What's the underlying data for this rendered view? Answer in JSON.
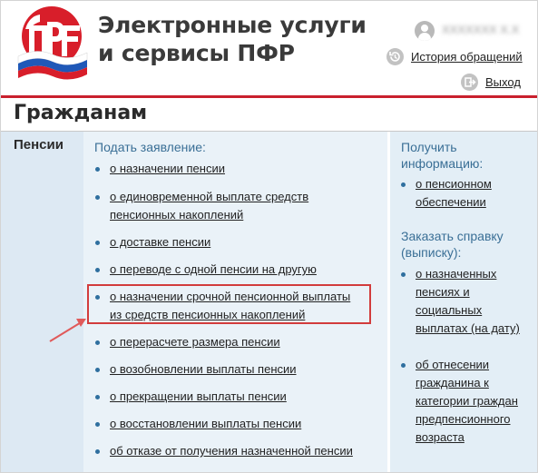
{
  "header": {
    "title_line1": "Электронные услуги",
    "title_line2": "и сервисы ПФР",
    "user_name": "XXXXXXX X.X.",
    "history_link": "История обращений",
    "exit_link": "Выход",
    "icons": {
      "logo": "pfr-logo-icon",
      "user": "user-icon",
      "history": "history-icon",
      "exit": "exit-icon"
    }
  },
  "section_title": "Гражданам",
  "category": "Пенсии",
  "main": {
    "heading": "Подать заявление:",
    "items": [
      {
        "lines": [
          "о назначении пенсии"
        ]
      },
      {
        "lines": [
          "о единовременной выплате средств",
          "пенсионных накоплений"
        ]
      },
      {
        "lines": [
          "о доставке пенсии"
        ]
      },
      {
        "lines": [
          "о переводе с одной пенсии на другую"
        ]
      },
      {
        "lines": [
          "о назначении срочной пенсионной выплаты",
          "из средств пенсионных накоплений"
        ]
      },
      {
        "lines": [
          "о перерасчете размера пенсии"
        ]
      },
      {
        "lines": [
          "о возобновлении выплаты пенсии"
        ]
      },
      {
        "lines": [
          "о прекращении выплаты пенсии"
        ]
      },
      {
        "lines": [
          "о восстановлении выплаты пенсии"
        ]
      },
      {
        "lines": [
          "об отказе от получения назначенной пенсии"
        ]
      }
    ]
  },
  "right": {
    "info_heading": [
      "Получить",
      "информацию:"
    ],
    "info_items": [
      {
        "lines": [
          "о пенсионном",
          "обеспечении"
        ]
      }
    ],
    "cert_heading": [
      "Заказать справку",
      "(выписку):"
    ],
    "cert_items": [
      {
        "lines": [
          "о назначенных",
          "пенсиях и",
          "социальных",
          "выплатах (на дату)"
        ]
      },
      {
        "lines": [
          "об отнесении",
          "гражданина к",
          "категории граждан",
          "предпенсионного",
          "возраста"
        ]
      }
    ]
  },
  "colors": {
    "brand_red": "#c9202d",
    "link_blue": "#3a6f96",
    "highlight_red": "#d23c3c"
  }
}
